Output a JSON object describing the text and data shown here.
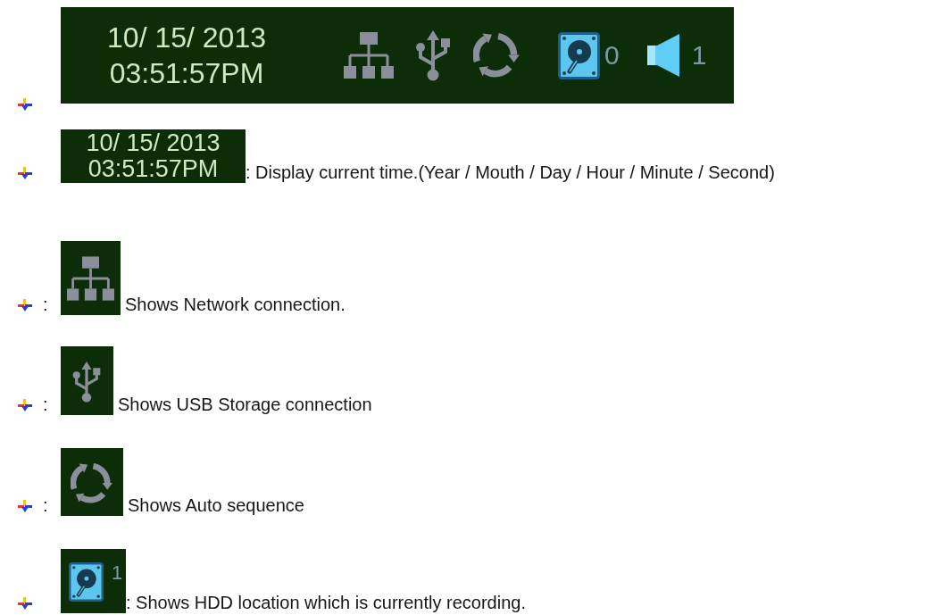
{
  "status_bar": {
    "date": "10/ 15/ 2013",
    "time": "03:51:57PM",
    "indicators": [
      {
        "kind": "network"
      },
      {
        "kind": "usb"
      },
      {
        "kind": "sequence"
      },
      {
        "kind": "hdd",
        "count": "0"
      },
      {
        "kind": "audio",
        "count": "1"
      }
    ]
  },
  "legend": [
    {
      "kind": "clock",
      "date": "10/ 15/ 2013",
      "time": "03:51:57PM",
      "text": ": Display current time.(Year / Mouth / Day / Hour / Minute / Second)"
    },
    {
      "kind": "network",
      "prefix": ":",
      "text": "Shows Network connection."
    },
    {
      "kind": "usb",
      "prefix": ":",
      "text": "Shows USB Storage connection"
    },
    {
      "kind": "sequence",
      "prefix": ":",
      "text": "Shows Auto sequence"
    },
    {
      "kind": "hdd",
      "count": "1",
      "text": ": Shows HDD location which is currently recording."
    }
  ]
}
